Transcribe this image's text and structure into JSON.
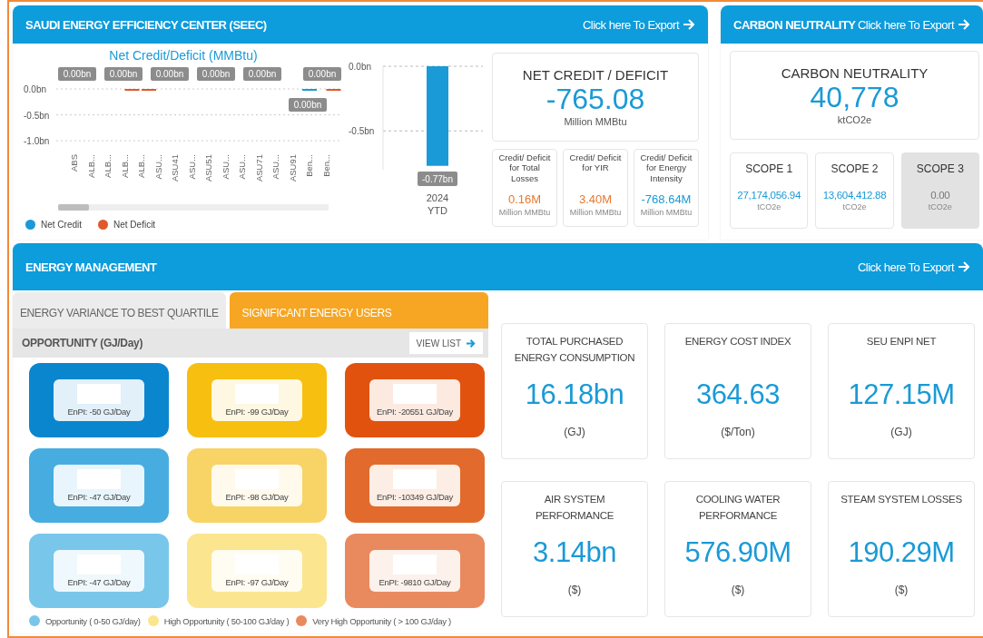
{
  "seec": {
    "title": "SAUDI ENERGY EFFICIENCY CENTER (SEEC)",
    "export_link": "Click here To Export",
    "chart": {
      "chart_data": {
        "type": "bar",
        "title": "Net Credit/Deficit (MMBtu)",
        "categories": [
          "ABS",
          "ALB...",
          "ALB...",
          "ALB...",
          "ALB...",
          "ASU...",
          "ASU41",
          "ASU...",
          "ASU51",
          "ASU...",
          "ASU...",
          "ASU71",
          "ASU...",
          "ASU91",
          "Ben...",
          "Ben..."
        ],
        "series": [
          {
            "name": "Net Credit",
            "color": "#1a9ad6",
            "values": [
              null,
              null,
              null,
              null,
              null,
              null,
              null,
              null,
              null,
              null,
              null,
              null,
              null,
              null,
              0,
              null
            ]
          },
          {
            "name": "Net Deficit",
            "color": "#e0592a",
            "values": [
              null,
              null,
              null,
              0,
              0,
              null,
              null,
              null,
              null,
              null,
              null,
              null,
              null,
              null,
              null,
              0
            ]
          }
        ],
        "ylim": [
          -1,
          0
        ],
        "grid": true,
        "yticks": [
          {
            "value": 0,
            "label": "0.0bn"
          },
          {
            "value": -0.5,
            "label": "-0.5bn"
          },
          {
            "value": -1,
            "label": "-1.0bn"
          }
        ],
        "value_labels": [
          "0.00bn",
          "0.00bn",
          "0.00bn",
          "0.00bn",
          "0.00bn",
          "0.00bn",
          "0.00bn"
        ]
      }
    },
    "ytd_chart": {
      "chart_data": {
        "type": "bar",
        "categories": [
          "2024"
        ],
        "xlabel": "YTD",
        "series": [
          {
            "color": "#1a9ad6",
            "values": [
              -0.77
            ]
          }
        ],
        "ylim": [
          -0.8,
          0
        ],
        "grid": true,
        "yticks": [
          {
            "value": 0,
            "label": "0.0bn"
          },
          {
            "value": -0.5,
            "label": "-0.5bn"
          }
        ],
        "value_labels": [
          "-0.77bn"
        ]
      }
    },
    "net": {
      "title": "NET CREDIT / DEFICIT",
      "value": "-765.08",
      "unit": "Million MMBtu"
    },
    "breakdown": [
      {
        "label": "Credit/ Deficit for Total Losses",
        "value": "0.16M",
        "unit": "Million MMBtu",
        "color": "#e8792e"
      },
      {
        "label": "Credit/ Deficit for YIR",
        "value": "3.40M",
        "unit": "Million MMBtu",
        "color": "#e8792e"
      },
      {
        "label": "Credit/ Deficit for Energy Intensity",
        "value": "-768.64M",
        "unit": "Million MMBtu",
        "color": "#1a9ad6"
      }
    ]
  },
  "carbon": {
    "title": "CARBON NEUTRALITY",
    "export_link": "Click here To Export",
    "main": {
      "title": "CARBON NEUTRALITY",
      "value": "40,778",
      "unit": "ktCO2e"
    },
    "scopes": [
      {
        "label": "SCOPE 1",
        "value": "27,174,056.94",
        "unit": "tCO2e",
        "disabled": false
      },
      {
        "label": "SCOPE 2",
        "value": "13,604,412.88",
        "unit": "tCO2e",
        "disabled": false
      },
      {
        "label": "SCOPE 3",
        "value": "0.00",
        "unit": "tCO2e",
        "disabled": true
      }
    ]
  },
  "energy": {
    "title": "ENERGY MANAGEMENT",
    "export_link": "Click here To Export",
    "tabs": [
      {
        "label": "ENERGY VARIANCE TO BEST QUARTILE",
        "selected": false
      },
      {
        "label": "SIGNIFICANT ENERGY USERS",
        "selected": true
      }
    ],
    "opportunity": {
      "title": "OPPORTUNITY (GJ/Day)",
      "button": "VIEW LIST"
    },
    "tiles": [
      {
        "enpi": "EnPI: -50 GJ/Day",
        "color": "#0a86cf"
      },
      {
        "enpi": "EnPI: -99 GJ/Day",
        "color": "#f7bf0f"
      },
      {
        "enpi": "EnPI: -20551 GJ/Day",
        "color": "#e2520f"
      },
      {
        "enpi": "EnPI: -47 GJ/Day",
        "color": "#47ade0"
      },
      {
        "enpi": "EnPI: -98 GJ/Day",
        "color": "#f8d466"
      },
      {
        "enpi": "EnPI: -10349 GJ/Day",
        "color": "#e26a2c"
      },
      {
        "enpi": "EnPI: -47 GJ/Day",
        "color": "#78c6ea"
      },
      {
        "enpi": "EnPI: -97 GJ/Day",
        "color": "#fbe58f"
      },
      {
        "enpi": "EnPI: -9810 GJ/Day",
        "color": "#e98a5e"
      }
    ],
    "legend": [
      {
        "label": "Opportunity ( 0-50 GJ/day)",
        "color": "#78c6ea"
      },
      {
        "label": "High Opportunity ( 50-100 GJ/day )",
        "color": "#fbe58f"
      },
      {
        "label": "Very High Opportunity (  > 100 GJ/day )",
        "color": "#e98a5e"
      }
    ],
    "metrics": [
      {
        "title": "TOTAL PURCHASED ENERGY CONSUMPTION",
        "value": "16.18bn",
        "unit": "(GJ)"
      },
      {
        "title": "ENERGY COST INDEX",
        "value": "364.63",
        "unit": "($/Ton)"
      },
      {
        "title": "SEU ENPI NET",
        "value": "127.15M",
        "unit": "(GJ)"
      },
      {
        "title": "AIR SYSTEM PERFORMANCE",
        "value": "3.14bn",
        "unit": "($)"
      },
      {
        "title": "COOLING WATER PERFORMANCE",
        "value": "576.90M",
        "unit": "($)"
      },
      {
        "title": "STEAM SYSTEM LOSSES",
        "value": "190.29M",
        "unit": "($)"
      }
    ]
  }
}
